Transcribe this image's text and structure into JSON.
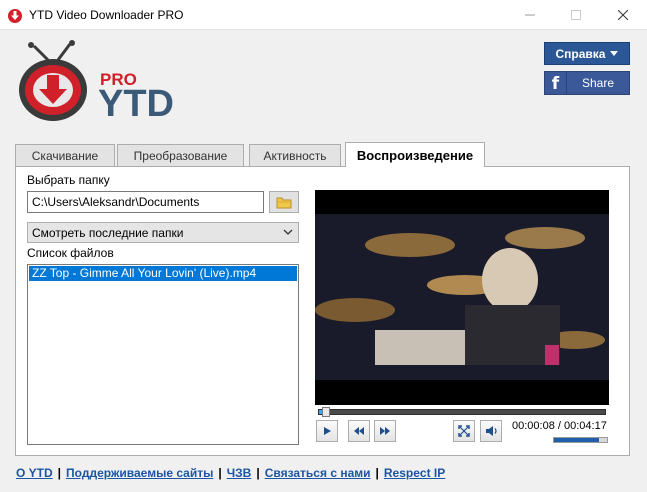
{
  "window": {
    "title": "YTD Video Downloader PRO"
  },
  "logo": {
    "badge": "PRO",
    "wordmark": "YTD"
  },
  "header": {
    "help_label": "Справка",
    "share_label": "Share",
    "share_brand": "f",
    "accent_color": "#2b5797",
    "facebook_color": "#3b5998"
  },
  "tabs": [
    {
      "label": "Скачивание",
      "active": false
    },
    {
      "label": "Преобразование",
      "active": false
    },
    {
      "label": "Активность",
      "active": false
    },
    {
      "label": "Воспроизведение",
      "active": true
    }
  ],
  "playback": {
    "folder_label": "Выбрать папку",
    "folder_value": "C:\\Users\\Aleksandr\\Documents",
    "recent_dropdown": "Смотреть последние папки",
    "files_label": "Список файлов",
    "files": [
      {
        "name": "ZZ Top - Gimme All Your Lovin' (Live).mp4",
        "selected": true
      }
    ]
  },
  "player": {
    "current_time": "00:00:08",
    "total_time": "00:04:17",
    "time_separator": " / ",
    "progress_fraction": 0.03,
    "volume_fraction": 0.85,
    "icons": [
      "play-icon",
      "rewind-icon",
      "fast-forward-icon",
      "fullscreen-icon",
      "volume-icon"
    ]
  },
  "footer": {
    "links": [
      "О YTD",
      "Поддерживаемые сайты",
      "ЧЗВ",
      "Связаться с нами",
      "Respect IP"
    ],
    "link_color": "#1c55a3"
  }
}
